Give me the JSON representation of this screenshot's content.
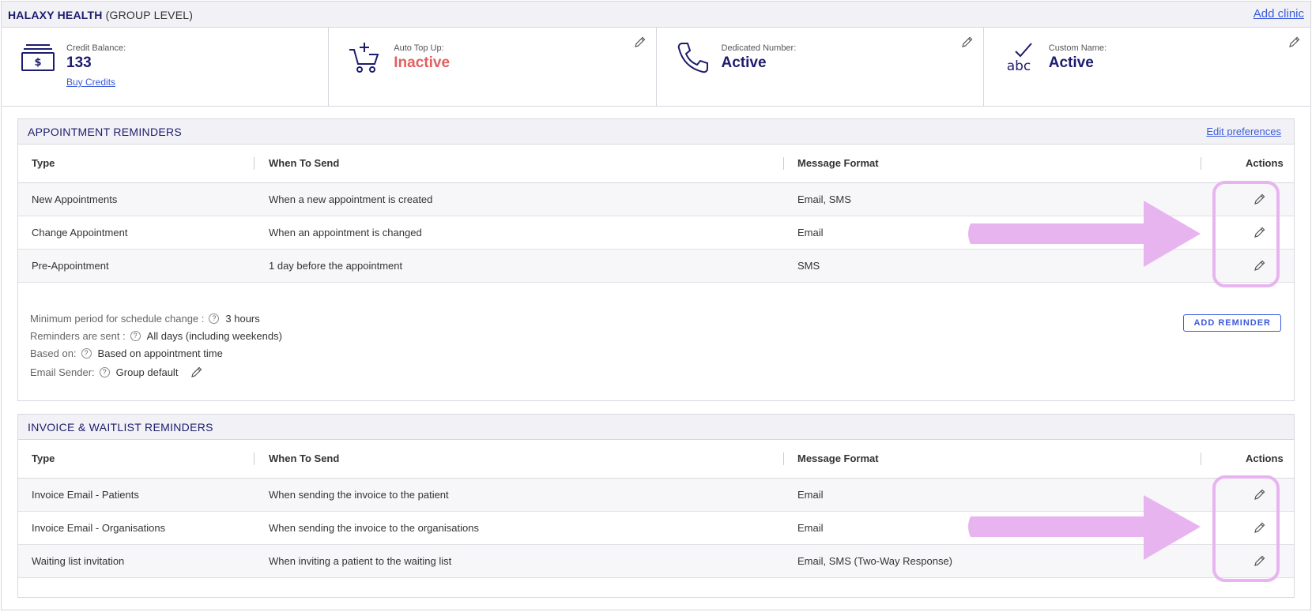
{
  "header": {
    "org_name": "HALAXY HEALTH",
    "org_level": "(GROUP LEVEL)",
    "add_clinic": "Add clinic"
  },
  "stats": [
    {
      "label": "Credit Balance:",
      "value": "133",
      "link": "Buy Credits",
      "icon": "dollar-bills-icon"
    },
    {
      "label": "Auto Top Up:",
      "value": "Inactive",
      "icon": "cart-plus-icon"
    },
    {
      "label": "Dedicated Number:",
      "value": "Active",
      "icon": "phone-icon"
    },
    {
      "label": "Custom Name:",
      "value": "Active",
      "icon": "abc-check-icon"
    }
  ],
  "appointment": {
    "title": "APPOINTMENT REMINDERS",
    "edit_link": "Edit preferences",
    "columns": {
      "type": "Type",
      "when": "When To Send",
      "format": "Message Format",
      "actions": "Actions"
    },
    "rows": [
      {
        "type": "New Appointments",
        "when": "When a new appointment is created",
        "format": "Email, SMS"
      },
      {
        "type": "Change Appointment",
        "when": "When an appointment is changed",
        "format": "Email"
      },
      {
        "type": "Pre-Appointment",
        "when": "1 day before the appointment",
        "format": "SMS"
      }
    ],
    "settings": [
      {
        "label": "Minimum period for schedule change :",
        "value": "3 hours"
      },
      {
        "label": "Reminders are sent :",
        "value": "All days (including weekends)"
      },
      {
        "label": "Based on:",
        "value": "Based on appointment time"
      },
      {
        "label": "Email Sender:",
        "value": "Group default"
      }
    ],
    "add_button": "ADD REMINDER"
  },
  "invoice": {
    "title": "INVOICE & WAITLIST REMINDERS",
    "columns": {
      "type": "Type",
      "when": "When To Send",
      "format": "Message Format",
      "actions": "Actions"
    },
    "rows": [
      {
        "type": "Invoice Email - Patients",
        "when": "When sending the invoice to the patient",
        "format": "Email"
      },
      {
        "type": "Invoice Email - Organisations",
        "when": "When sending the invoice to the organisations",
        "format": "Email"
      },
      {
        "type": "Waiting list invitation",
        "when": "When inviting a patient to the waiting list",
        "format": "Email, SMS (Two-Way Response)"
      }
    ]
  },
  "colors": {
    "brand": "#1c1c6e",
    "link": "#3b5bdb",
    "inactive": "#e06060",
    "highlight": "#e8b4f0"
  }
}
